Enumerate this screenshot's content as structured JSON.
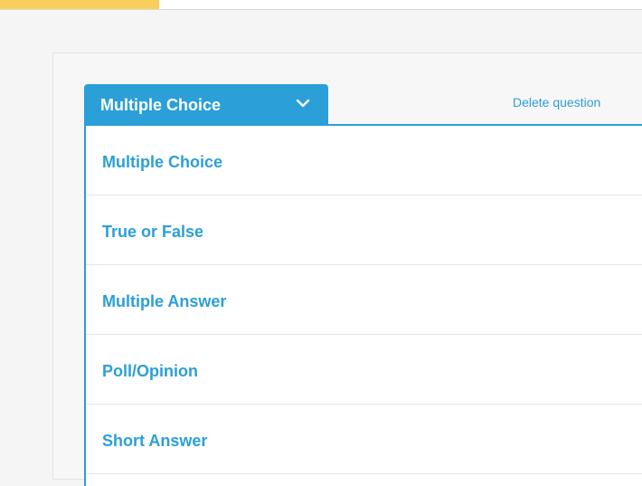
{
  "colors": {
    "accent": "#2b9fd8",
    "top_accent": "#f9cf5b"
  },
  "question_type_select": {
    "selected": "Multiple Choice",
    "icon": "chevron-down-icon"
  },
  "delete_question_label": "Delete question",
  "menu": {
    "items": [
      {
        "label": "Multiple Choice"
      },
      {
        "label": "True or False"
      },
      {
        "label": "Multiple Answer"
      },
      {
        "label": "Poll/Opinion"
      },
      {
        "label": "Short Answer"
      }
    ]
  }
}
